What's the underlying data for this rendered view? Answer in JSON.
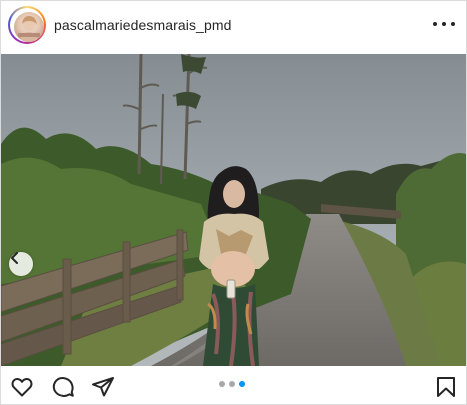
{
  "post": {
    "username": "pascalmariedesmarais_pmd",
    "avatar_icon": "profile-avatar",
    "more_icon": "more-horizontal-icon"
  },
  "carousel": {
    "total_slides": 3,
    "active_slide": 3,
    "prev_icon": "chevron-left-icon",
    "active_dot_color": "#0095f6",
    "inactive_dot_color": "#a8a8a8"
  },
  "actions": {
    "like_icon": "heart-icon",
    "comment_icon": "comment-icon",
    "share_icon": "send-icon",
    "save_icon": "bookmark-icon"
  },
  "colors": {
    "story_ring": [
      "#feda75",
      "#fa7e1e",
      "#d62976",
      "#962fbf",
      "#4f5bd5"
    ],
    "text": "#262626",
    "border": "#dbdbdb"
  }
}
